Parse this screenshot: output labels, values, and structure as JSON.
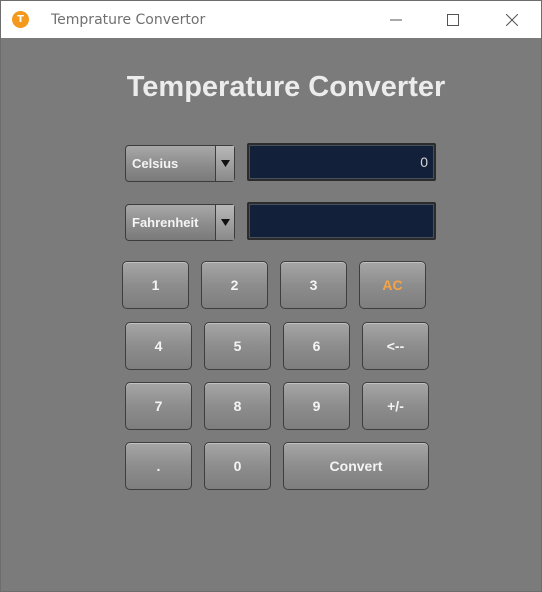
{
  "window": {
    "title": "Temprature Convertor",
    "icon_letter": "T",
    "controls": [
      "minimize-icon",
      "maximize-icon",
      "close-icon"
    ]
  },
  "main": {
    "heading": "Temperature Converter",
    "from_unit": "Celsius",
    "to_unit": "Fahrenheit",
    "input_value": "0",
    "output_value": ""
  },
  "keypad": {
    "k1": "1",
    "k2": "2",
    "k3": "3",
    "clear": "AC",
    "k4": "4",
    "k5": "5",
    "k6": "6",
    "backspace": "<--",
    "k7": "7",
    "k8": "8",
    "k9": "9",
    "sign": "+/-",
    "dot": ".",
    "k0": "0",
    "convert": "Convert"
  },
  "colors": {
    "background": "#7b7b7b",
    "display": "#13203a",
    "accent": "#f5a445",
    "app_icon": "#f39a1e"
  }
}
